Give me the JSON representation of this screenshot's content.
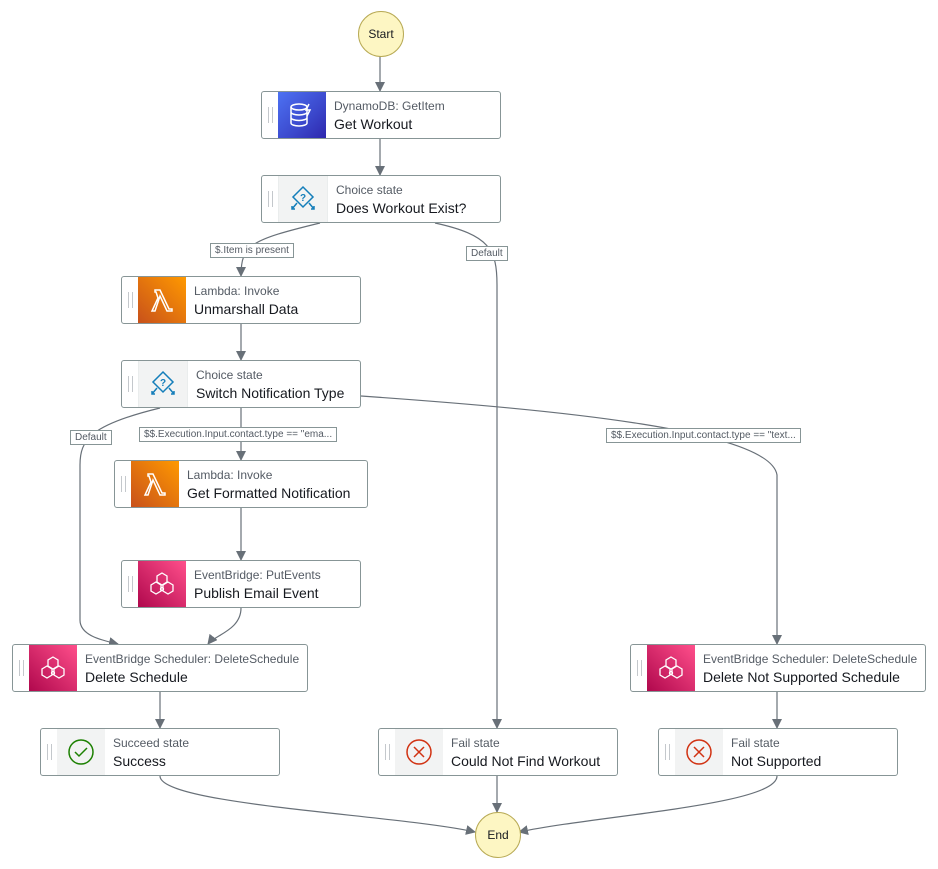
{
  "start_label": "Start",
  "end_label": "End",
  "colors": {
    "dynamodb": "#3b48cc",
    "lambda": "#e8711a",
    "eventbridge": "#d6246e",
    "choice": "#147eba",
    "succeed": "#1d8102",
    "fail": "#d13212"
  },
  "states": [
    {
      "id": "get-workout",
      "type": "DynamoDB: GetItem",
      "name": "Get Workout",
      "icon": "dynamodb-icon"
    },
    {
      "id": "does-workout-exist",
      "type": "Choice state",
      "name": "Does Workout Exist?",
      "icon": "choice-icon"
    },
    {
      "id": "unmarshall-data",
      "type": "Lambda: Invoke",
      "name": "Unmarshall Data",
      "icon": "lambda-icon"
    },
    {
      "id": "switch-notification-type",
      "type": "Choice state",
      "name": "Switch Notification Type",
      "icon": "choice-icon"
    },
    {
      "id": "get-formatted-notification",
      "type": "Lambda: Invoke",
      "name": "Get Formatted Notification",
      "icon": "lambda-icon"
    },
    {
      "id": "publish-email-event",
      "type": "EventBridge: PutEvents",
      "name": "Publish Email Event",
      "icon": "eventbridge-icon"
    },
    {
      "id": "delete-schedule",
      "type": "EventBridge Scheduler: DeleteSchedule",
      "name": "Delete Schedule",
      "icon": "eventbridge-icon"
    },
    {
      "id": "delete-not-supported-schedule",
      "type": "EventBridge Scheduler: DeleteSchedule",
      "name": "Delete Not Supported Schedule",
      "icon": "eventbridge-icon"
    },
    {
      "id": "success",
      "type": "Succeed state",
      "name": "Success",
      "icon": "succeed-icon"
    },
    {
      "id": "could-not-find-workout",
      "type": "Fail state",
      "name": "Could Not Find Workout",
      "icon": "fail-icon"
    },
    {
      "id": "not-supported",
      "type": "Fail state",
      "name": "Not Supported",
      "icon": "fail-icon"
    }
  ],
  "edge_labels": [
    {
      "id": "item-present",
      "text": "$.Item is present"
    },
    {
      "id": "default-1",
      "text": "Default"
    },
    {
      "id": "default-2",
      "text": "Default"
    },
    {
      "id": "email",
      "text": "$$.Execution.Input.contact.type == \"ema..."
    },
    {
      "id": "text",
      "text": "$$.Execution.Input.contact.type == \"text..."
    }
  ]
}
